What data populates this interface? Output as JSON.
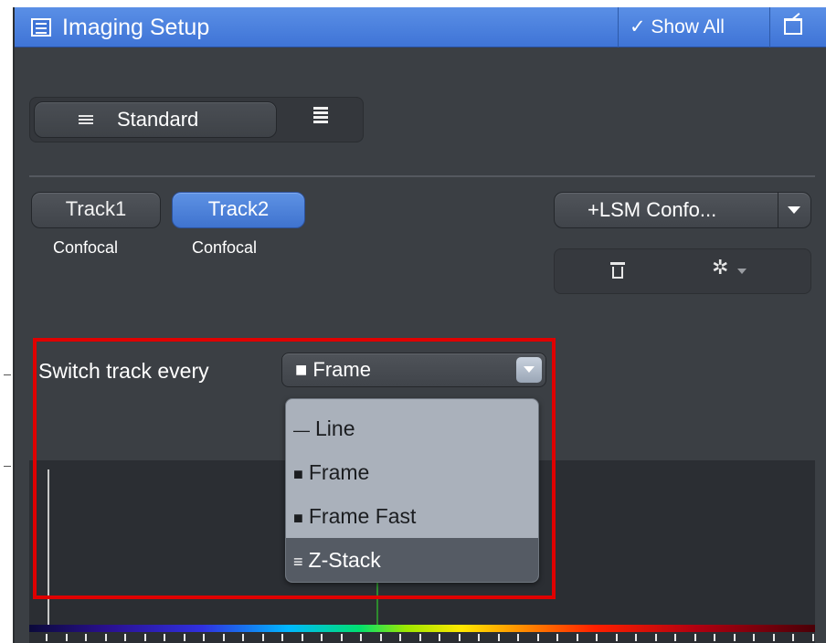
{
  "header": {
    "title": "Imaging Setup",
    "show_all": "✓ Show All",
    "icon": "imaging-setup-icon",
    "undock_icon": "undock-icon"
  },
  "mode": {
    "standard_label": "Standard"
  },
  "tracks": [
    {
      "label": "Track1",
      "sub": "Confocal",
      "selected": false
    },
    {
      "label": "Track2",
      "sub": "Confocal",
      "selected": true
    }
  ],
  "lsm": {
    "label": "+LSM Confo..."
  },
  "tools": {
    "delete_icon": "trash-icon",
    "settings_icon": "gear-icon"
  },
  "switch_track": {
    "label": "Switch track every",
    "value": "■ Frame",
    "options": [
      {
        "icon": "—",
        "label": "Line"
      },
      {
        "icon": "■",
        "label": "Frame"
      },
      {
        "icon": "■",
        "label": "Frame Fast"
      },
      {
        "icon": "≡",
        "label": "Z-Stack"
      }
    ],
    "highlighted_option": "Z-Stack"
  },
  "colors": {
    "header": "#4a82e0",
    "panel": "#3b3f44",
    "selected_track": "#4f86de",
    "highlight_border": "#e00000",
    "dropdown_bg": "#aab1bb",
    "dropdown_selected": "#555b64"
  }
}
